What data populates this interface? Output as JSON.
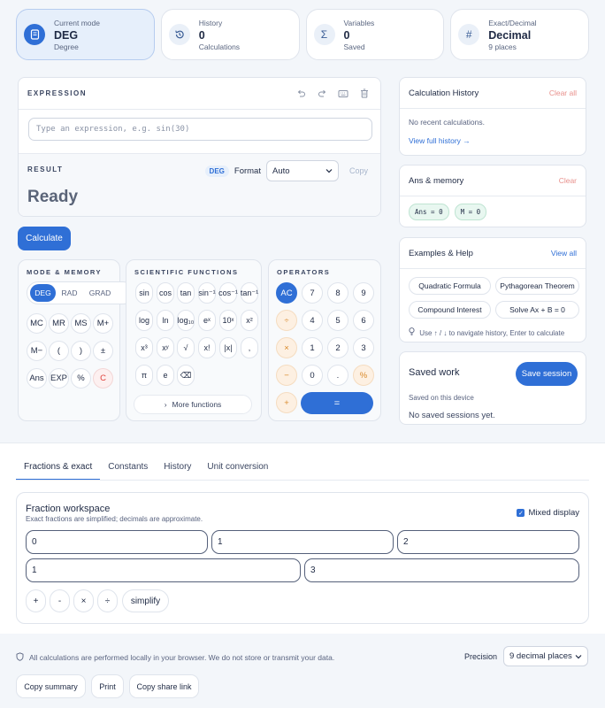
{
  "stats": [
    {
      "label": "Current mode",
      "value": "DEG",
      "sub": "Degree",
      "icon": "file-icon"
    },
    {
      "label": "History",
      "value": "0",
      "sub": "Calculations",
      "icon": "history-icon"
    },
    {
      "label": "Variables",
      "value": "0",
      "sub": "Saved",
      "icon": "sigma-icon"
    },
    {
      "label": "Exact/Decimal",
      "value": "Decimal",
      "sub": "9 places",
      "icon": "hash-icon"
    }
  ],
  "expression": {
    "title": "EXPRESSION",
    "placeholder": "Type an expression, e.g. sin(30)",
    "result_label": "RESULT",
    "angle_badge": "DEG",
    "format_label": "Format",
    "format_value": "Auto",
    "copy_label": "Copy",
    "result_value": "Ready"
  },
  "calculate_label": "Calculate",
  "mode_memory": {
    "title": "MODE & MEMORY",
    "angles": [
      "DEG",
      "RAD",
      "GRAD"
    ],
    "selected_angle": "DEG",
    "keys": [
      "MC",
      "MR",
      "MS",
      "M+",
      "M−",
      "(",
      ")",
      "±",
      "Ans",
      "EXP",
      "%",
      "C"
    ]
  },
  "scientific": {
    "title": "SCIENTIFIC FUNCTIONS",
    "keys": [
      "sin",
      "cos",
      "tan",
      "sin⁻¹",
      "cos⁻¹",
      "tan⁻¹",
      "log",
      "ln",
      "log₁₀",
      "eˣ",
      "10ˣ",
      "x²",
      "x³",
      "xʸ",
      "√",
      "x!",
      "|x|",
      ",",
      "π",
      "e",
      "⌫"
    ],
    "more_label": "More functions"
  },
  "operators": {
    "title": "OPERATORS",
    "keys": [
      "AC",
      "7",
      "8",
      "9",
      "÷",
      "4",
      "5",
      "6",
      "×",
      "1",
      "2",
      "3",
      "−",
      "0",
      ".",
      "%",
      "+"
    ],
    "equals": "="
  },
  "history": {
    "title": "Calculation History",
    "clear_label": "Clear all",
    "empty_text": "No recent calculations.",
    "view_link": "View full history →"
  },
  "memory": {
    "title": "Ans & memory",
    "clear_label": "Clear",
    "pills": [
      "Ans = 0",
      "M = 0"
    ]
  },
  "examples": {
    "title": "Examples & Help",
    "view_label": "View all",
    "items": [
      "Quadratic Formula",
      "Pythagorean Theorem",
      "Compound Interest",
      "Solve Ax + B = 0"
    ],
    "hint": "Use ↑ / ↓ to navigate history, Enter to calculate"
  },
  "saved": {
    "title": "Saved work",
    "save_label": "Save session",
    "sub": "Saved on this device",
    "empty": "No saved sessions yet."
  },
  "tabs": [
    "Fractions & exact",
    "Constants",
    "History",
    "Unit conversion"
  ],
  "active_tab": "Fractions & exact",
  "fraction": {
    "title": "Fraction workspace",
    "sub": "Exact fractions are simplified; decimals are approximate.",
    "mixed_label": "Mixed display",
    "mixed_checked": true,
    "fields_row1": [
      "0",
      "1",
      "2"
    ],
    "fields_row2": [
      "1",
      "3"
    ],
    "ops": [
      "+",
      "-",
      "×",
      "÷",
      "simplify"
    ]
  },
  "footer": {
    "privacy": "All calculations are performed locally in your browser. We do not store or transmit your data.",
    "precision_label": "Precision",
    "precision_value": "9 decimal places",
    "buttons": [
      "Copy summary",
      "Print",
      "Copy share link"
    ]
  },
  "colors": {
    "accent": "#2f6fd6",
    "danger": "#e0403a",
    "operator": "#d98a2b",
    "memory_pill": "#e8f7f0"
  }
}
